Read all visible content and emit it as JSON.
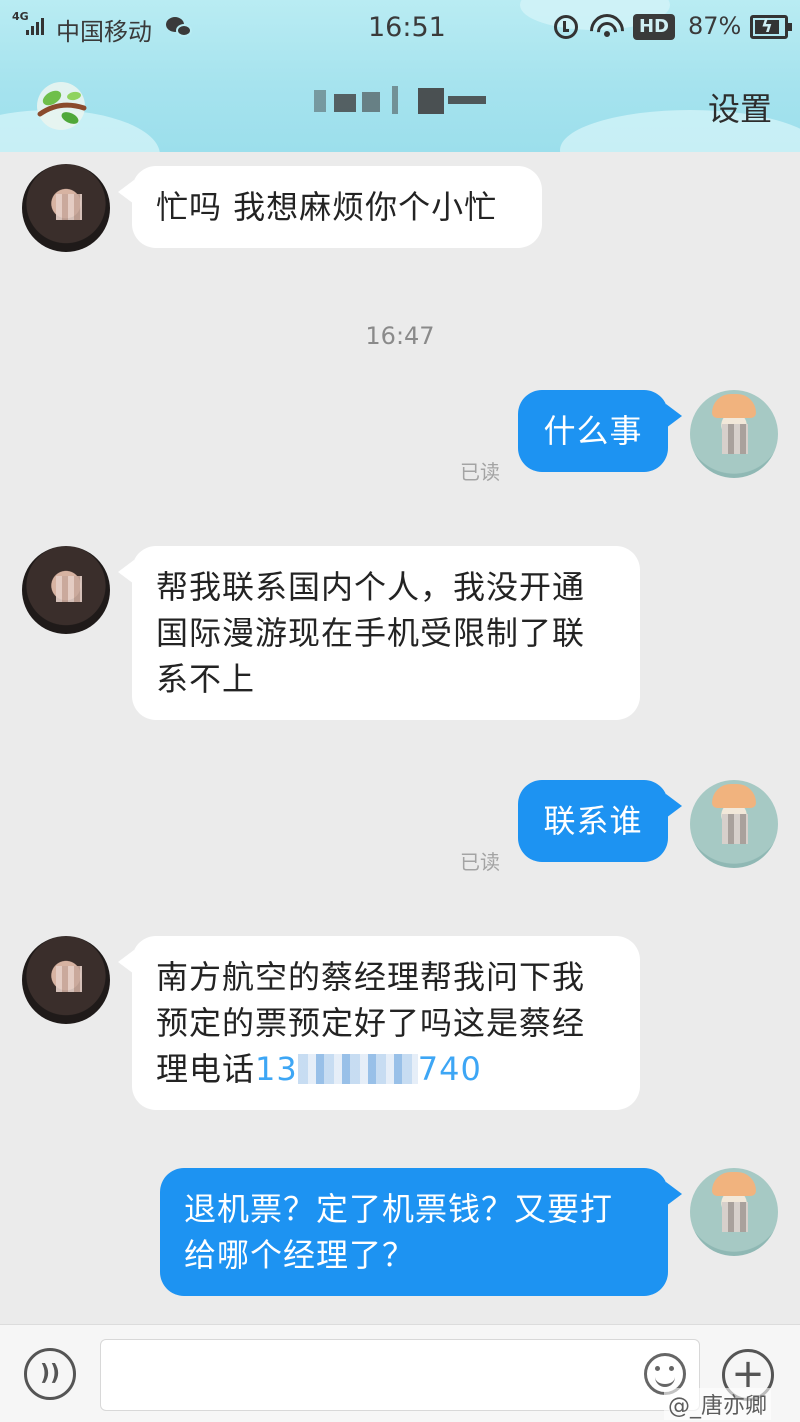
{
  "status_bar": {
    "network": "4G",
    "carrier": "中国移动",
    "time": "16:51",
    "hd_badge": "HD",
    "battery": "87%",
    "battery_level": 0.87,
    "icons": [
      "signal-icon",
      "wechat-icon",
      "alarm-icon",
      "wifi-icon",
      "battery-icon"
    ]
  },
  "header": {
    "logo_icon": "branch-logo-icon",
    "settings_label": "设置"
  },
  "conversation": {
    "messages": [
      {
        "side": "in",
        "text": "忙吗 我想麻烦你个小忙"
      },
      {
        "side": "out",
        "text": "什么事",
        "read": "已读"
      },
      {
        "side": "in",
        "text": "帮我联系国内个人，我没开通国际漫游现在手机受限制了联系不上"
      },
      {
        "side": "out",
        "text": "联系谁",
        "read": "已读"
      },
      {
        "side": "in",
        "text_before": "南方航空的蔡经理帮我问下我预定的票预定好了吗这是蔡经理电话",
        "phone_prefix": "13",
        "phone_suffix": "740"
      },
      {
        "side": "out",
        "text": "退机票？定了机票钱？又要打给哪个经理了？"
      }
    ],
    "timestamp": "16:47"
  },
  "input_bar": {
    "voice_icon": "voice-icon",
    "voice_glyph": "))",
    "placeholder": "",
    "emoji_icon": "emoji-icon",
    "plus_icon": "plus-icon",
    "plus_glyph": "+"
  },
  "watermark": "@_唐亦卿",
  "colors": {
    "header_bg": "#a6e3ee",
    "chat_bg": "#ebebeb",
    "outgoing_bubble": "#1d93f2",
    "incoming_bubble": "#ffffff",
    "phone_link": "#3da6f5"
  }
}
